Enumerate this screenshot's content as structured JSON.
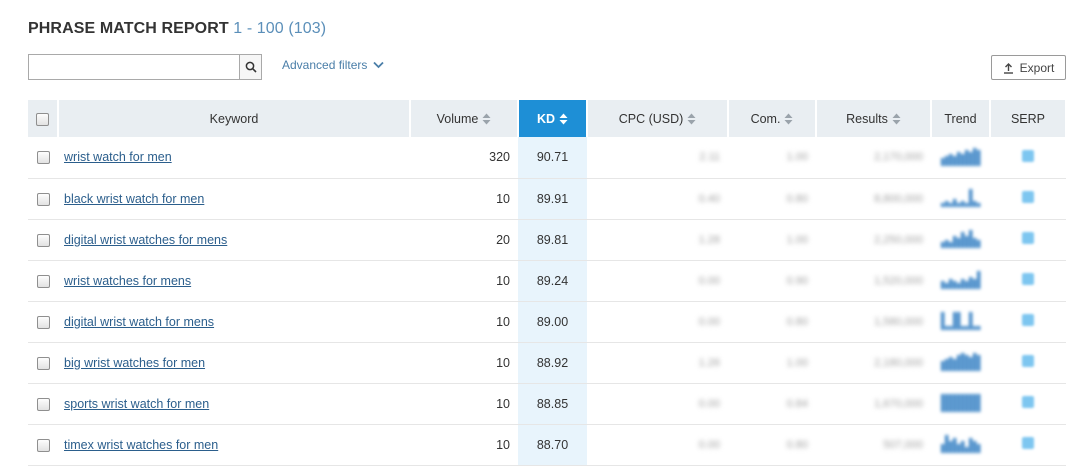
{
  "header": {
    "title": "PHRASE MATCH REPORT",
    "range": "1 - 100 (103)"
  },
  "search": {
    "value": "",
    "placeholder": ""
  },
  "advanced_filters_label": "Advanced filters",
  "export_label": "Export",
  "columns": {
    "keyword": "Keyword",
    "volume": "Volume",
    "kd": "KD",
    "cpc": "CPC (USD)",
    "com": "Com.",
    "results": "Results",
    "trend": "Trend",
    "serp": "SERP"
  },
  "rows": [
    {
      "keyword": "wrist watch for men",
      "volume": "320",
      "kd": "90.71",
      "cpc": "2.11",
      "com": "1.00",
      "results": "2,170,000",
      "trend": [
        4,
        5,
        6,
        5,
        7,
        6,
        8,
        7,
        9,
        8
      ]
    },
    {
      "keyword": "black wrist watch for men",
      "volume": "10",
      "kd": "89.91",
      "cpc": "0.40",
      "com": "0.80",
      "results": "8,800,000",
      "trend": [
        2,
        3,
        2,
        4,
        2,
        3,
        2,
        9,
        3,
        2
      ]
    },
    {
      "keyword": "digital wrist watches for mens",
      "volume": "20",
      "kd": "89.81",
      "cpc": "1.28",
      "com": "1.00",
      "results": "2,250,000",
      "trend": [
        3,
        4,
        3,
        6,
        5,
        8,
        6,
        9,
        5,
        4
      ]
    },
    {
      "keyword": "wrist watches for mens",
      "volume": "10",
      "kd": "89.24",
      "cpc": "0.00",
      "com": "0.90",
      "results": "1,520,000",
      "trend": [
        4,
        3,
        5,
        4,
        3,
        5,
        4,
        6,
        5,
        9
      ]
    },
    {
      "keyword": "digital wrist watch for mens",
      "volume": "10",
      "kd": "89.00",
      "cpc": "0.00",
      "com": "0.80",
      "results": "1,580,000",
      "trend": [
        9,
        2,
        2,
        9,
        9,
        2,
        2,
        9,
        2,
        2
      ]
    },
    {
      "keyword": "big wrist watches for men",
      "volume": "10",
      "kd": "88.92",
      "cpc": "1.26",
      "com": "1.00",
      "results": "2,180,000",
      "trend": [
        5,
        6,
        7,
        6,
        8,
        9,
        8,
        7,
        9,
        8
      ]
    },
    {
      "keyword": "sports wrist watch for men",
      "volume": "10",
      "kd": "88.85",
      "cpc": "0.00",
      "com": "0.84",
      "results": "1,670,000",
      "trend": [
        9,
        9,
        9,
        9,
        9,
        9,
        9,
        9,
        9,
        9
      ]
    },
    {
      "keyword": "timex wrist watches for men",
      "volume": "10",
      "kd": "88.70",
      "cpc": "0.00",
      "com": "0.80",
      "results": "507,000",
      "trend": [
        3,
        6,
        4,
        5,
        3,
        4,
        2,
        5,
        4,
        3
      ]
    }
  ],
  "colors": {
    "accent": "#1e8fd6",
    "kd_column_bg": "#e8f4fc",
    "header_bg": "#e9eef2",
    "link": "#2b5e8c",
    "trend_bar": "#3f86c6",
    "serp_icon": "#7dc6f0"
  },
  "icons": {
    "search": "magnifier-icon",
    "advanced_filters": "chevron-down-icon",
    "export": "upload-icon",
    "sort": "sort-arrows-icon"
  }
}
